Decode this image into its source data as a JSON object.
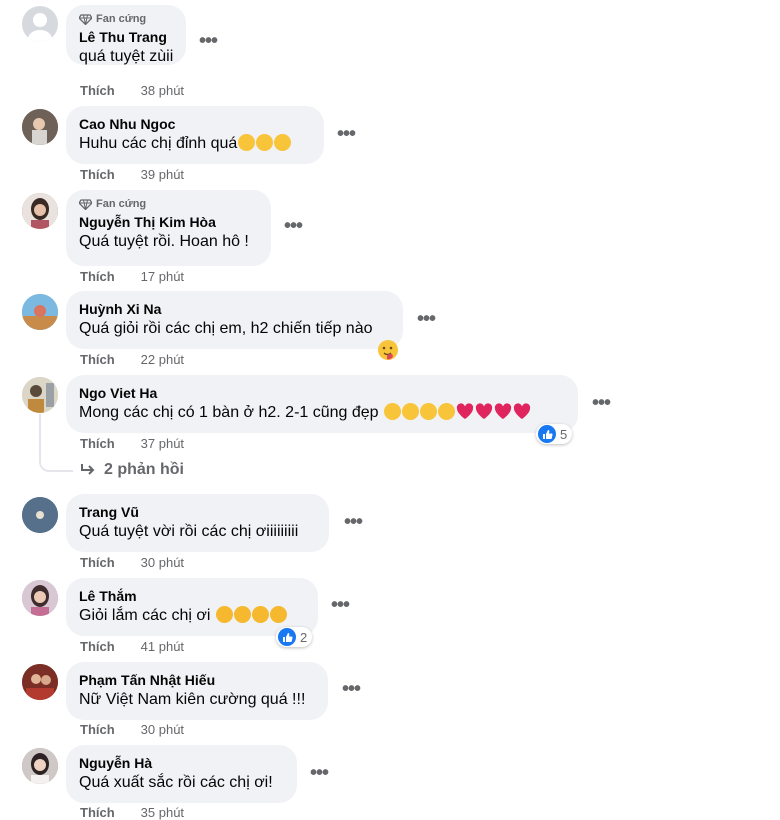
{
  "comments": [
    {
      "badge": "Fan cứng",
      "author": "Lê Thu Trang",
      "text": "quá tuyệt zùii",
      "like": "Thích",
      "time": "38 phút",
      "emojis": [],
      "reactions": null,
      "avatar_color": "#d6d9de"
    },
    {
      "badge": "",
      "author": "Cao Nhu Ngoc",
      "text": "Huhu các chị đỉnh quá",
      "like": "Thích",
      "time": "39 phút",
      "emojis": [
        "pleading-face",
        "pleading-face",
        "pleading-face"
      ],
      "reactions": null,
      "avatar_color": "#8a7a6e"
    },
    {
      "badge": "Fan cứng",
      "author": "Nguyễn Thị Kim Hòa",
      "text": "Quá tuyệt rồi. Hoan hô !",
      "like": "Thích",
      "time": "17 phút",
      "emojis": [],
      "reactions": null,
      "avatar_color": "#a4806e"
    },
    {
      "badge": "",
      "author": "Huỳnh Xi Na",
      "text": "Quá giỏi rồi các chị em, h2 chiến tiếp nào",
      "like": "Thích",
      "time": "22 phút",
      "emojis": [],
      "reactions": null,
      "avatar_color": "#5aa3d4"
    },
    {
      "badge": "",
      "author": "Ngo Viet Ha",
      "text": "Mong các chị có 1 bàn ở h2. 2-1 cũng đẹp",
      "like": "Thích",
      "time": "37 phút",
      "emojis": [
        "hug-face",
        "hug-face",
        "hug-face",
        "hug-face",
        "heart",
        "heart",
        "heart",
        "heart"
      ],
      "reactions": "5",
      "avatar_color": "#c9c4b5"
    },
    {
      "badge": "",
      "author": "Trang Vũ",
      "text": "Quá tuyệt vời rồi các chị ơiiiiiiiii",
      "like": "Thích",
      "time": "30 phút",
      "emojis": [],
      "reactions": null,
      "avatar_color": "#5b7894"
    },
    {
      "badge": "",
      "author": "Lê Thắm",
      "text": "Giỏi lắm các chị ơi",
      "like": "Thích",
      "time": "41 phút",
      "emojis": [
        "heart-eyes",
        "heart-eyes",
        "heart-eyes",
        "heart-eyes"
      ],
      "reactions": "2",
      "avatar_color": "#b58da6"
    },
    {
      "badge": "",
      "author": "Phạm Tấn Nhật Hiếu",
      "text": "Nữ Việt Nam kiên cường quá !!!",
      "like": "Thích",
      "time": "30 phút",
      "emojis": [],
      "reactions": null,
      "avatar_color": "#9a4a3c"
    },
    {
      "badge": "",
      "author": "Nguyễn Hà",
      "text": "Quá xuất sắc rồi các chị ơi!",
      "like": "Thích",
      "time": "35 phút",
      "emojis": [],
      "reactions": null,
      "avatar_color": "#8f8688"
    }
  ],
  "replies_link": "2 phản hồi",
  "icons": {
    "badge": "diamond-icon",
    "more": "more-options-icon",
    "reply": "reply-arrow-icon",
    "like_reaction": "like-reaction-icon",
    "hug_sticker": "hug-sticker-icon"
  },
  "colors": {
    "bubble": "#f0f2f5",
    "secondary_text": "#65676b",
    "like_blue": "#1877f2"
  }
}
